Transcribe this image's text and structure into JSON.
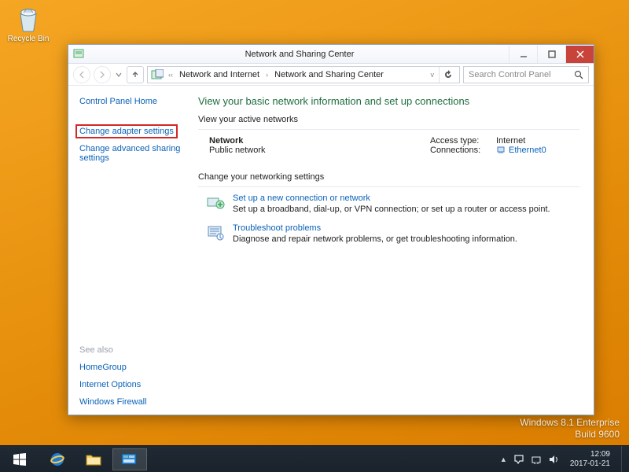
{
  "desktop": {
    "recycle_bin_label": "Recycle Bin"
  },
  "watermark": {
    "line1": "Windows 8.1 Enterprise",
    "line2": "Build 9600"
  },
  "window": {
    "title": "Network and Sharing Center",
    "breadcrumbs": {
      "root_icon": "control-panel",
      "b1": "Network and Internet",
      "b2": "Network and Sharing Center"
    },
    "search_placeholder": "Search Control Panel"
  },
  "sidebar": {
    "home": "Control Panel Home",
    "link_adapter": "Change adapter settings",
    "link_advanced": "Change advanced sharing settings",
    "see_also_heading": "See also",
    "see_also": {
      "homegroup": "HomeGroup",
      "internet_options": "Internet Options",
      "firewall": "Windows Firewall"
    }
  },
  "main": {
    "heading": "View your basic network information and set up connections",
    "active_networks_label": "View your active networks",
    "network": {
      "name": "Network",
      "type": "Public network",
      "access_type_label": "Access type:",
      "access_type_value": "Internet",
      "connections_label": "Connections:",
      "connections_value": "Ethernet0"
    },
    "change_settings_label": "Change your networking settings",
    "items": {
      "setup": {
        "title": "Set up a new connection or network",
        "desc": "Set up a broadband, dial-up, or VPN connection; or set up a router or access point."
      },
      "troubleshoot": {
        "title": "Troubleshoot problems",
        "desc": "Diagnose and repair network problems, or get troubleshooting information."
      }
    }
  },
  "taskbar": {
    "clock_time": "12:09",
    "clock_date": "2017-01-21"
  }
}
